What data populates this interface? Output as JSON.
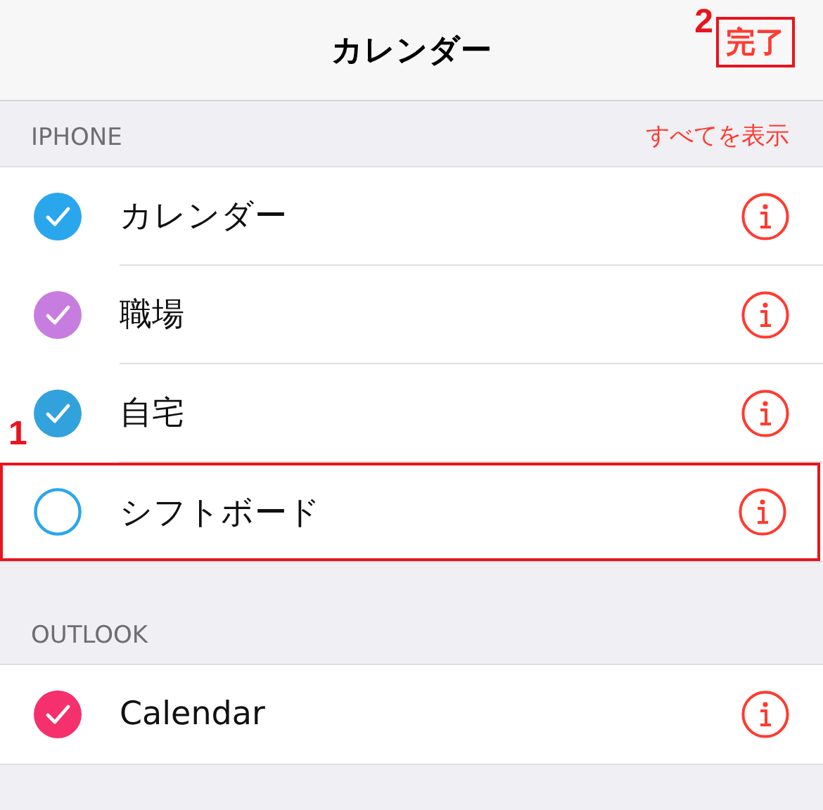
{
  "nav": {
    "title": "カレンダー",
    "done": "完了",
    "done_highlighted": true,
    "done_callout": "2"
  },
  "sections": [
    {
      "header": "IPHONE",
      "action": "すべてを表示",
      "calendars": [
        {
          "name": "カレンダー",
          "checked": true,
          "color": "#2aa6ec",
          "highlighted": false
        },
        {
          "name": "職場",
          "checked": true,
          "color": "#c77ddf",
          "highlighted": false
        },
        {
          "name": "自宅",
          "checked": true,
          "color": "#32a2dc",
          "highlighted": false
        },
        {
          "name": "シフトボード",
          "checked": false,
          "color": "#2aa6ec",
          "highlighted": true,
          "callout": "1"
        }
      ]
    },
    {
      "header": "OUTLOOK",
      "calendars": [
        {
          "name": "Calendar",
          "checked": true,
          "color": "#f5306c",
          "highlighted": false
        }
      ]
    }
  ]
}
